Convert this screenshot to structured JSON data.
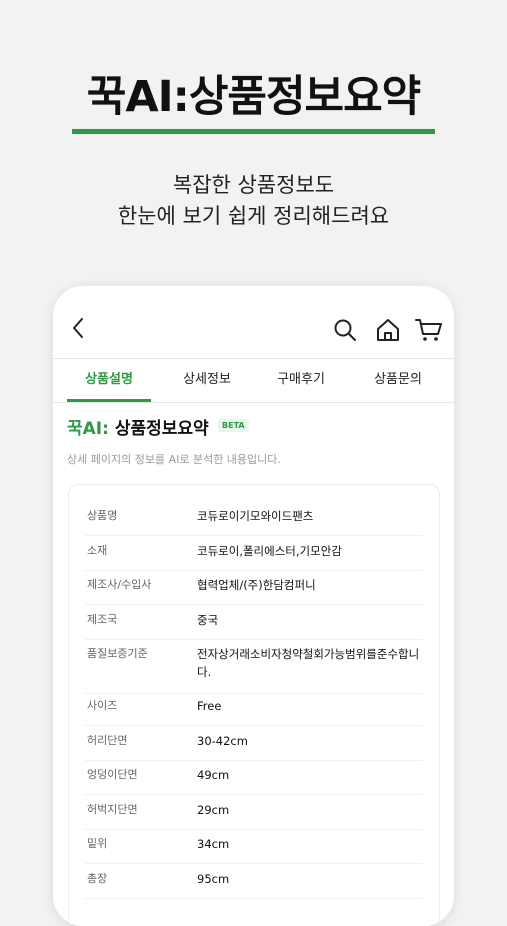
{
  "hero": {
    "title": "꾹AI:상품정보요약",
    "subtitle_line1": "복잡한 상품정보도",
    "subtitle_line2": "한눈에 보기 쉽게 정리해드려요"
  },
  "icons": {
    "back": "chevron-left-icon",
    "search": "search-icon",
    "home": "home-icon",
    "cart": "cart-icon"
  },
  "tabs": [
    {
      "label": "상품설명",
      "active": true
    },
    {
      "label": "상세정보",
      "active": false
    },
    {
      "label": "구매후기",
      "active": false
    },
    {
      "label": "상품문의",
      "active": false
    }
  ],
  "section": {
    "brand": "꾹AI:",
    "title": " 상품정보요약",
    "badge": "BETA",
    "caption": "상세 페이지의 정보를 AI로 분석한 내용입니다."
  },
  "info_rows": [
    {
      "key": "상품명",
      "value": "코듀로이기모와이드팬츠"
    },
    {
      "key": "소재",
      "value": "코듀로이,폴리에스터,기모안감"
    },
    {
      "key": "제조사/수입사",
      "value": "협력업체/(주)한담컴퍼니"
    },
    {
      "key": "제조국",
      "value": "중국"
    },
    {
      "key": "품질보증기준",
      "value": "전자상거래소비자청약철회가능범위를준수합니다."
    },
    {
      "key": "사이즈",
      "value": "Free"
    },
    {
      "key": "허리단면",
      "value": "30-42cm"
    },
    {
      "key": "엉덩이단면",
      "value": "49cm"
    },
    {
      "key": "허벅지단면",
      "value": "29cm"
    },
    {
      "key": "밑위",
      "value": "34cm"
    },
    {
      "key": "총장",
      "value": "95cm"
    }
  ],
  "colors": {
    "accent": "#2f9a45",
    "background": "#f2f2f2"
  }
}
